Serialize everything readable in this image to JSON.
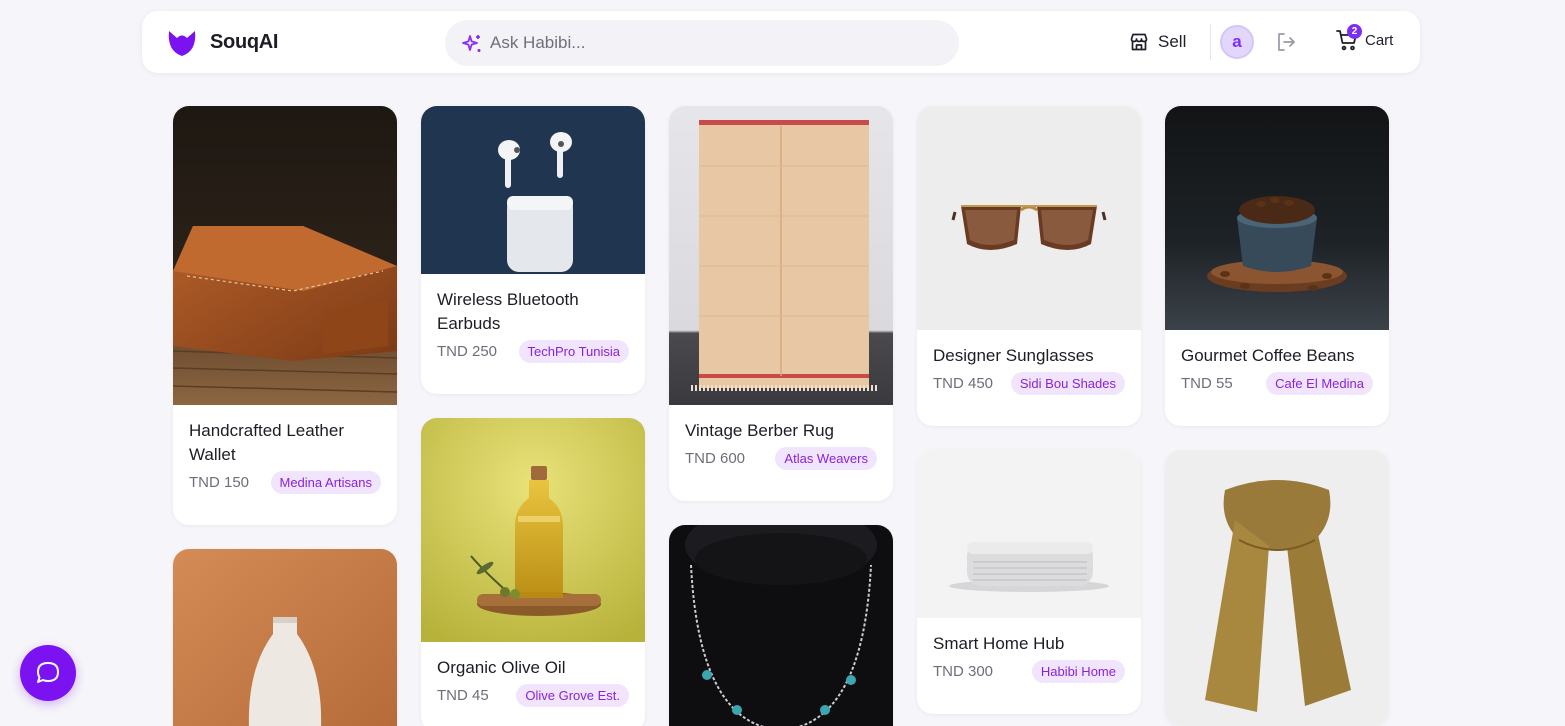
{
  "header": {
    "brand": "SouqAI",
    "search_placeholder": "Ask Habibi...",
    "sell_label": "Sell",
    "avatar_initial": "a",
    "cart_label": "Cart",
    "cart_count": "2"
  },
  "colors": {
    "accent": "#7b2ff2",
    "badge_bg": "#f1e4fd",
    "badge_text": "#8a23d8",
    "page_bg": "#f6f5f9"
  },
  "products": [
    {
      "title": "Handcrafted Leather Wallet",
      "price": "TND 150",
      "seller": "Medina Artisans"
    },
    {
      "title": "Wireless Bluetooth Earbuds",
      "price": "TND 250",
      "seller": "TechPro Tunisia"
    },
    {
      "title": "Vintage Berber Rug",
      "price": "TND 600",
      "seller": "Atlas Weavers"
    },
    {
      "title": "Designer Sunglasses",
      "price": "TND 450",
      "seller": "Sidi Bou Shades"
    },
    {
      "title": "Gourmet Coffee Beans",
      "price": "TND 55",
      "seller": "Cafe El Medina"
    },
    {
      "title": "Organic Olive Oil",
      "price": "TND 45",
      "seller": "Olive Grove Est."
    },
    {
      "title": "Smart Home Hub",
      "price": "TND 300",
      "seller": "Habibi Home"
    }
  ],
  "icons": {
    "logo": "souqai-logo-icon",
    "search": "sparkle-icon",
    "sell": "store-icon",
    "logout": "logout-icon",
    "cart": "cart-icon",
    "chat": "chat-bubble-icon"
  }
}
